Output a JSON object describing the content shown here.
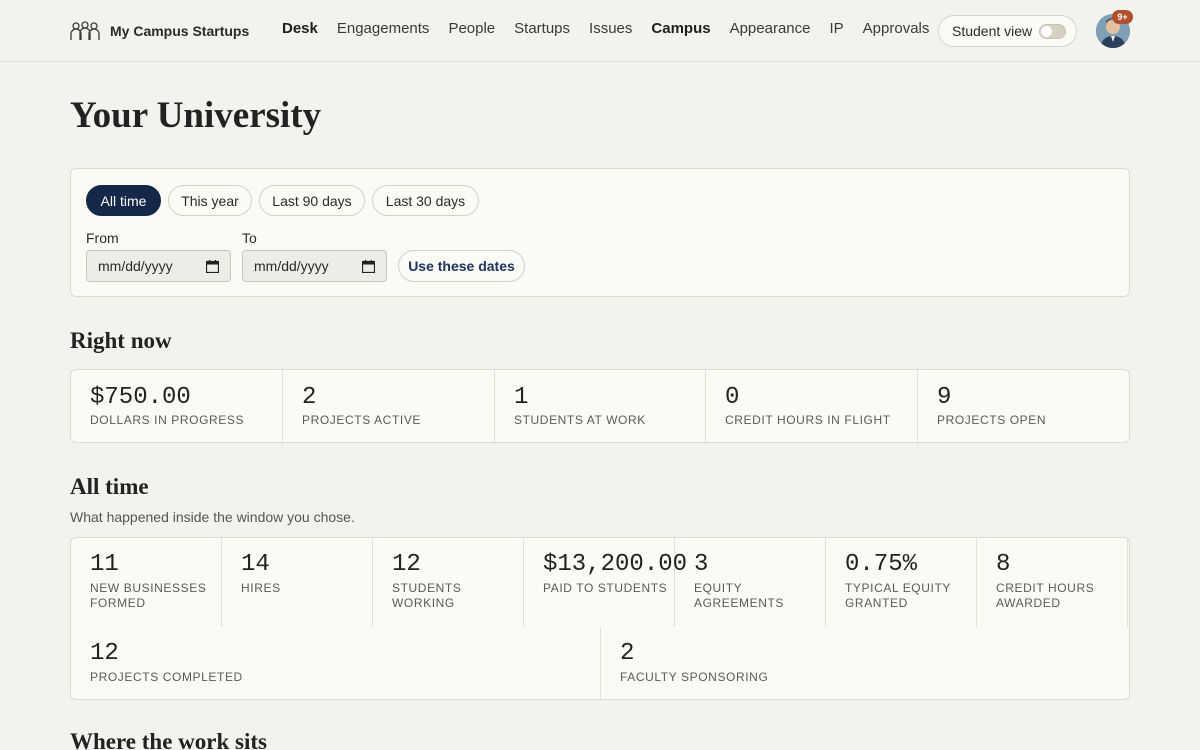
{
  "header": {
    "brand": "My Campus Startups",
    "nav": [
      "Desk",
      "Engagements",
      "People",
      "Startups",
      "Issues",
      "Campus",
      "Appearance",
      "IP",
      "Approvals"
    ],
    "active_nav": "Campus",
    "student_view_label": "Student view",
    "student_view_on": false,
    "notification_badge": "9+"
  },
  "page_title": "Your University",
  "filters": {
    "ranges": [
      "All time",
      "This year",
      "Last 90 days",
      "Last 30 days"
    ],
    "active_range": "All time",
    "from_label": "From",
    "to_label": "To",
    "from_value": "mm/dd/yyyy",
    "to_value": "mm/dd/yyyy",
    "apply_label": "Use these dates"
  },
  "right_now": {
    "title": "Right now",
    "stats": [
      {
        "value": "$750.00",
        "label": "Dollars in progress"
      },
      {
        "value": "2",
        "label": "Projects active"
      },
      {
        "value": "1",
        "label": "Students at work"
      },
      {
        "value": "0",
        "label": "Credit hours in flight"
      },
      {
        "value": "9",
        "label": "Projects open"
      }
    ]
  },
  "all_time": {
    "title": "All time",
    "subtitle": "What happened inside the window you chose.",
    "stats": [
      {
        "value": "11",
        "label": "New businesses formed"
      },
      {
        "value": "14",
        "label": "Hires"
      },
      {
        "value": "12",
        "label": "Students working"
      },
      {
        "value": "$13,200.00",
        "label": "Paid to students"
      },
      {
        "value": "3",
        "label": "Equity agreements"
      },
      {
        "value": "0.75%",
        "label": "Typical equity granted"
      },
      {
        "value": "8",
        "label": "Credit hours awarded"
      },
      {
        "value": "12",
        "label": "Projects completed"
      },
      {
        "value": "2",
        "label": "Faculty sponsoring"
      }
    ]
  },
  "next_section_title": "Where the work sits"
}
